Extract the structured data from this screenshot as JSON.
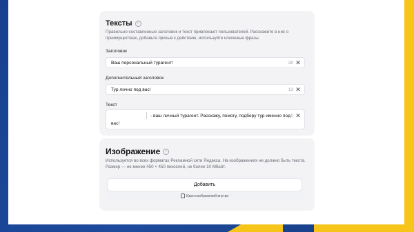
{
  "texts_section": {
    "title": "Тексты",
    "description": "Правильно составленные заголовок и текст привлекают пользователей. Расскажите в них о преимуществах, добавьте призыв к действию, используйте ключевые фразы.",
    "headline": {
      "label": "Заголовок",
      "value": "Ваш персональный турагент!",
      "counter": "30"
    },
    "extra_headline": {
      "label": "Дополнительный заголовок",
      "value": "Тур лично под вас!",
      "counter": "13"
    },
    "text": {
      "label": "Текст",
      "value_line1": "- ваш личный турагент. Расскажу, помогу, подберу тур именно под",
      "value_line2": "вас!",
      "counter": "0"
    }
  },
  "image_section": {
    "title": "Изображение",
    "description": "Используется во всех форматах Рекламной сети Яндекса. На изображениях не должно быть текста. Размер — не менее 450 × 450 пикселей, не более 10 Мбайт.",
    "add_button": "Добавить",
    "hint": "Идеи изображений внутри"
  },
  "icons": {
    "info": "info-icon",
    "clear": "close-icon",
    "idea": "lightbulb-icon"
  },
  "colors": {
    "background_blue": "#1d4a9c",
    "background_yellow": "#f7c51a",
    "panel": "#ffffff"
  }
}
